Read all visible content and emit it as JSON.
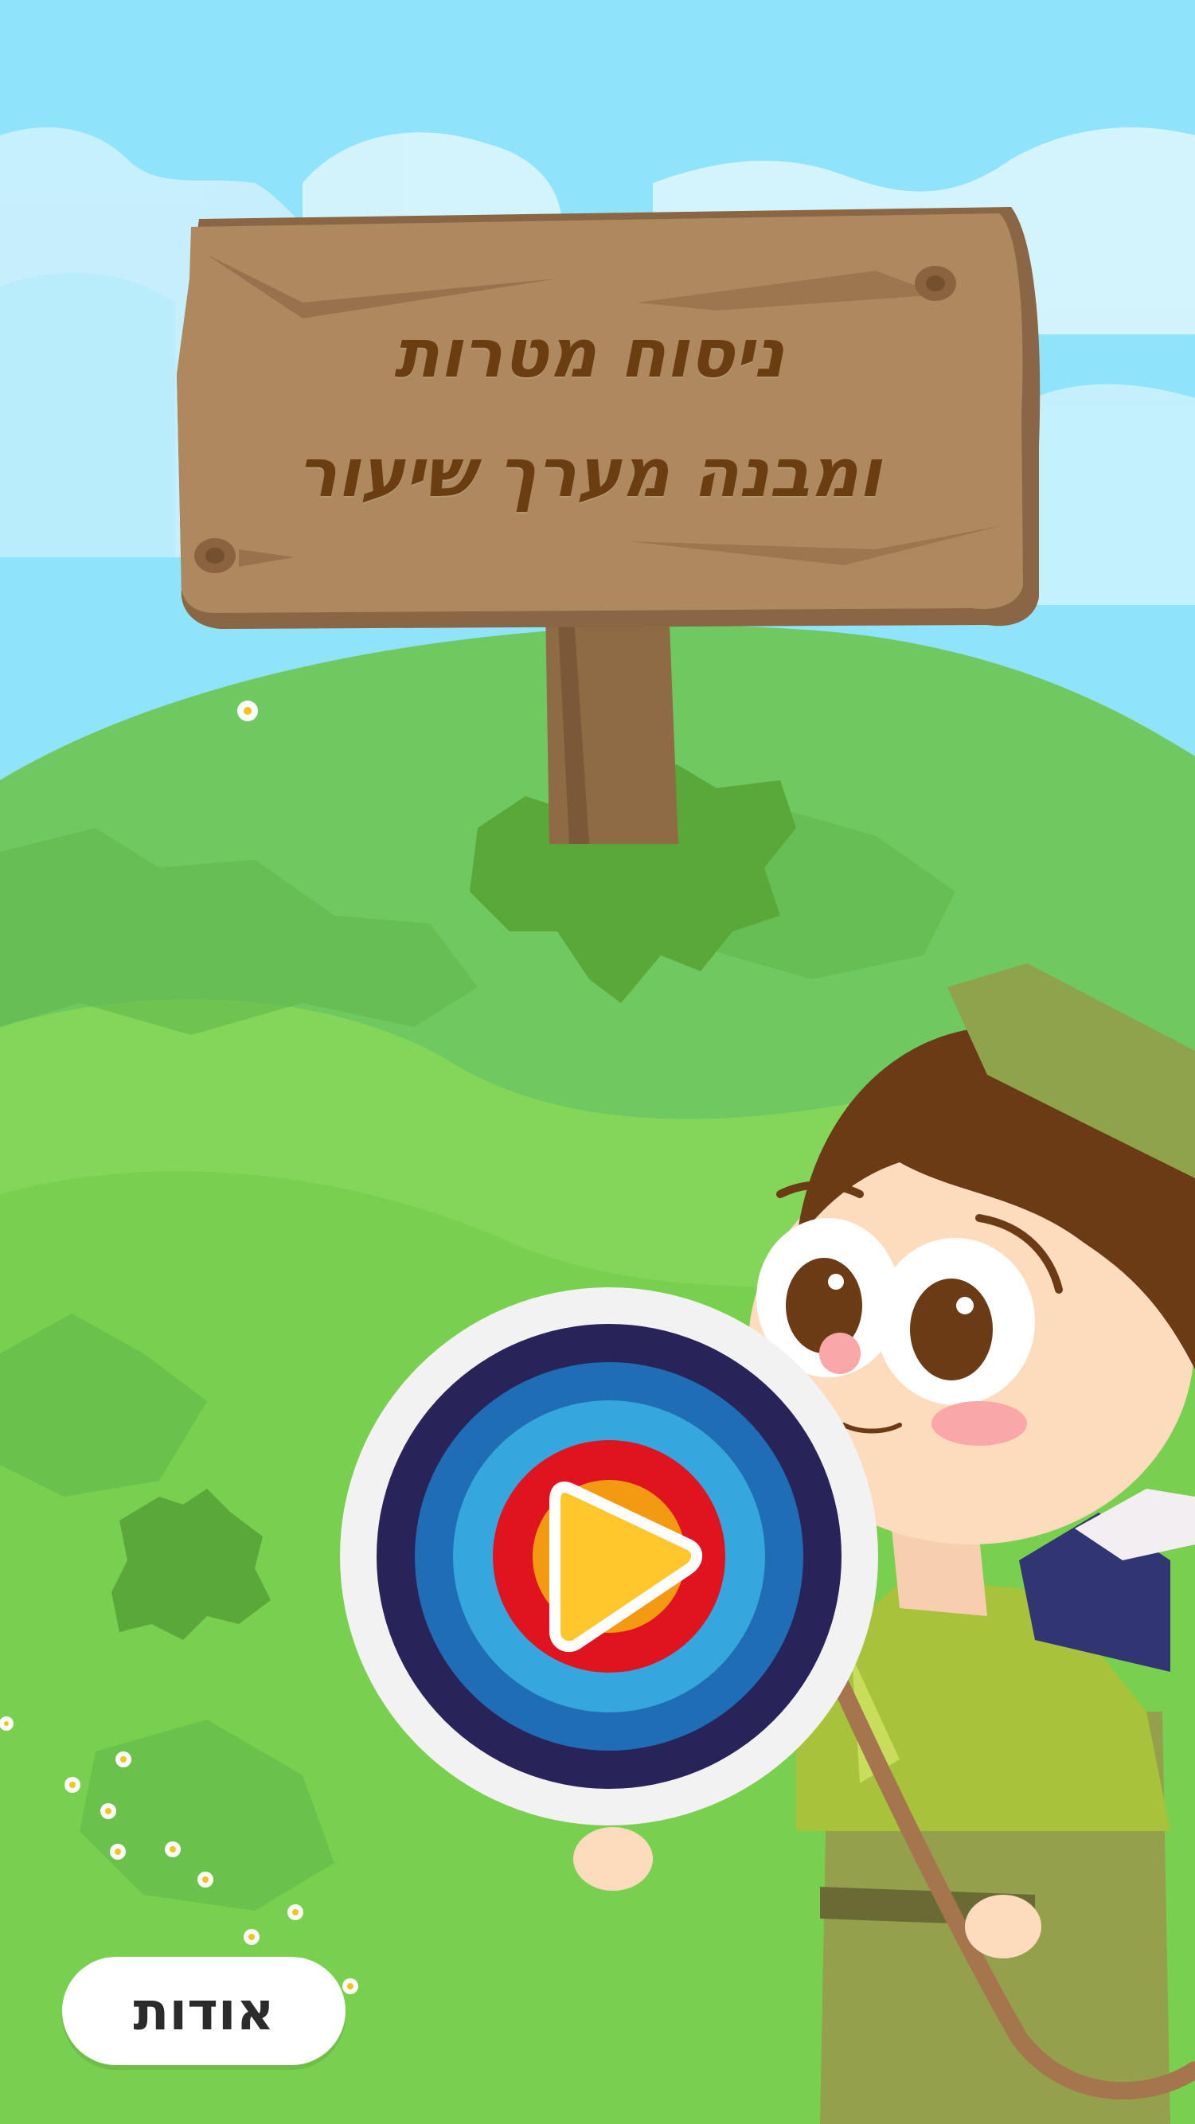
{
  "title": {
    "line1": "ניסוח מטרות",
    "line2": "ומבנה מערך שיעור"
  },
  "buttons": {
    "play_icon": "play-icon",
    "about_label": "אודות"
  },
  "colors": {
    "sky": "#8fe3fb",
    "grass": "#7cd054",
    "wood": "#ae885f",
    "wood_text": "#6b3e12",
    "target_outer": "#28245a",
    "target_blue": "#1f6db5",
    "target_light_blue": "#35a7de",
    "target_red": "#e0141f",
    "target_orange": "#f49a12",
    "play_yellow": "#ffc72c"
  }
}
